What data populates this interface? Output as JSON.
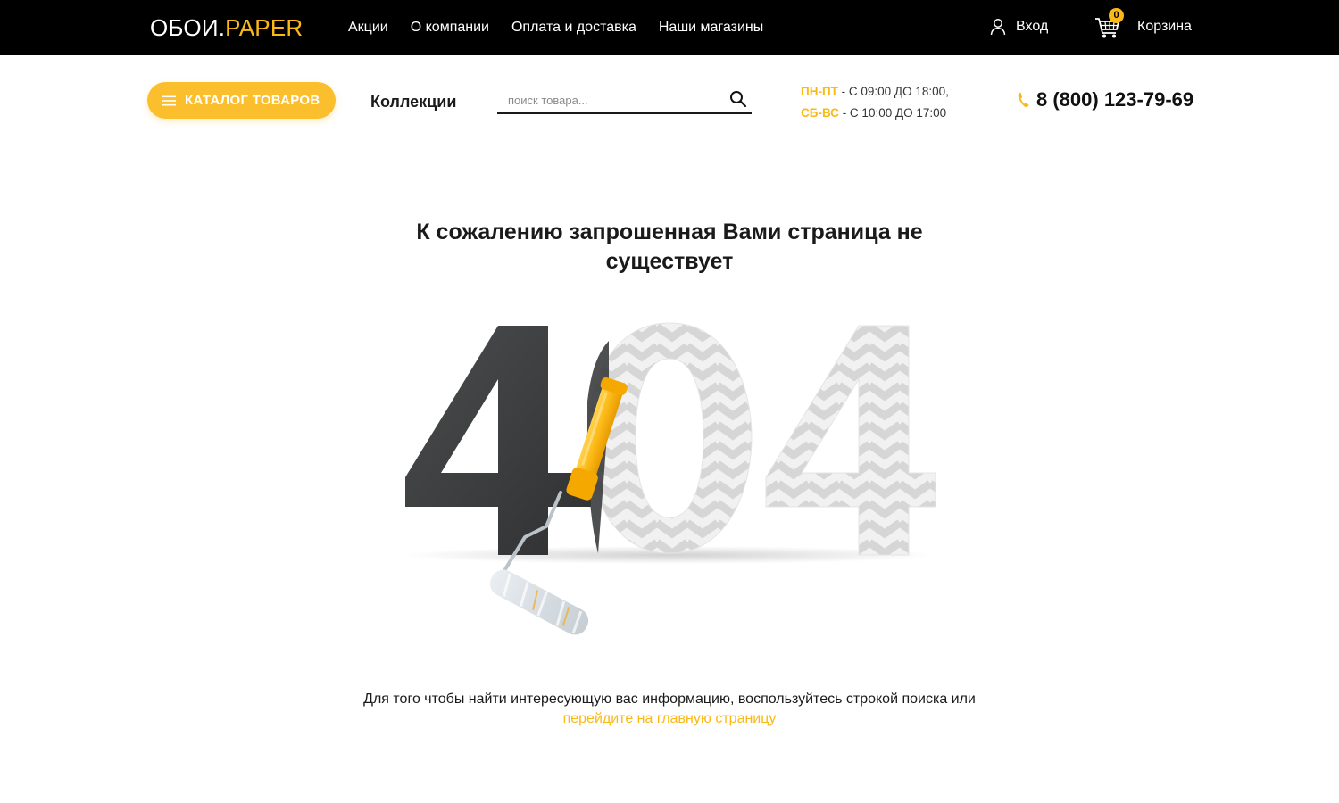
{
  "header": {
    "logo_part1": "ОБОИ.",
    "logo_part2": "PAPER",
    "nav": [
      {
        "label": "Акции"
      },
      {
        "label": "О компании"
      },
      {
        "label": "Оплата и доставка"
      },
      {
        "label": "Наши магазины"
      }
    ],
    "login_label": "Вход",
    "cart_label": "Корзина",
    "cart_count": "0"
  },
  "subheader": {
    "catalog_label": "КАТАЛОГ ТОВАРОВ",
    "collections_label": "Коллекции",
    "search_placeholder": "поиск товара...",
    "hours": {
      "weekday_days": "ПН-ПТ",
      "weekday_time": " - С 09:00 ДО 18:00,",
      "weekend_days": "СБ-ВС",
      "weekend_time": " - С 10:00 ДО 17:00"
    },
    "phone": "8 (800) 123-79-69"
  },
  "main": {
    "title": "К сожалению запрошенная Вами страница не существует",
    "error_code": "404",
    "message_text": "Для того чтобы найти интересующую вас информацию, воспользуйтесь строкой поиска или ",
    "home_link_label": "перейдите на главную страницу"
  },
  "colors": {
    "accent": "#fbb917",
    "topbar": "#000000",
    "digit_dark": "#3d3f40",
    "digit_light": "#eeeeee",
    "stripe": "#d9d9d9"
  },
  "icons": {
    "menu": "hamburger-icon",
    "search": "search-icon",
    "phone": "phone-icon",
    "user": "user-icon",
    "cart": "cart-icon",
    "roller": "paint-roller-icon"
  }
}
